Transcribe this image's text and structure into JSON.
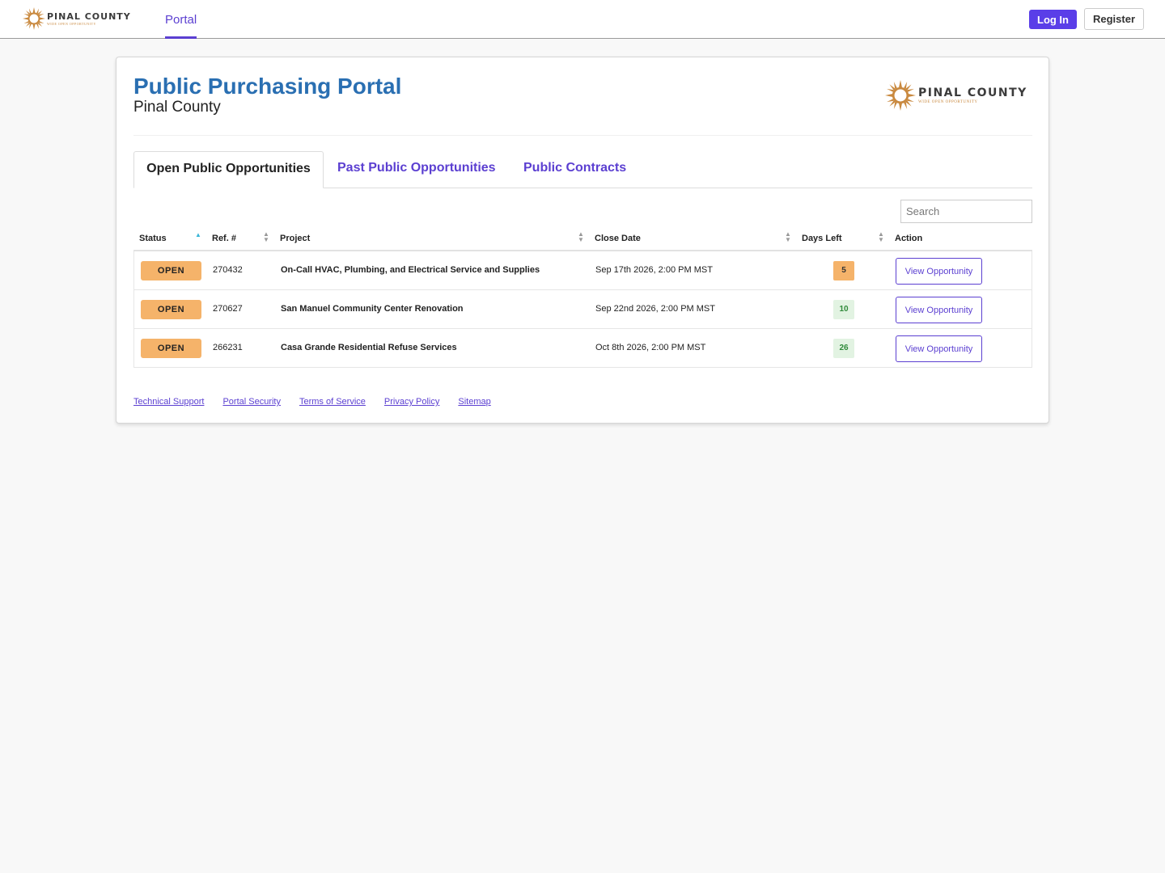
{
  "brand": {
    "name": "PINAL COUNTY",
    "tagline": "WIDE OPEN OPPORTUNITY"
  },
  "nav": {
    "portal_label": "Portal",
    "login_label": "Log In",
    "register_label": "Register"
  },
  "header": {
    "title": "Public Purchasing Portal",
    "subtitle": "Pinal County"
  },
  "tabs": [
    {
      "label": "Open Public Opportunities",
      "active": true
    },
    {
      "label": "Past Public Opportunities",
      "active": false
    },
    {
      "label": "Public Contracts",
      "active": false
    }
  ],
  "search": {
    "placeholder": "Search"
  },
  "table": {
    "columns": [
      "Status",
      "Ref. #",
      "Project",
      "Close Date",
      "Days Left",
      "Action"
    ],
    "rows": [
      {
        "status": "OPEN",
        "ref": "270432",
        "project": "On-Call HVAC, Plumbing, and Electrical Service and Supplies",
        "close_date": "Sep 17th 2026, 2:00 PM MST",
        "days_left": "5",
        "action": "View Opportunity"
      },
      {
        "status": "OPEN",
        "ref": "270627",
        "project": "San Manuel Community Center Renovation",
        "close_date": "Sep 22nd 2026, 2:00 PM MST",
        "days_left": "10",
        "action": "View Opportunity"
      },
      {
        "status": "OPEN",
        "ref": "266231",
        "project": "Casa Grande Residential Refuse Services",
        "close_date": "Oct 8th 2026, 2:00 PM MST",
        "days_left": "26",
        "action": "View Opportunity"
      }
    ]
  },
  "footer": {
    "links": [
      "Technical Support",
      "Portal Security",
      "Terms of Service",
      "Privacy Policy",
      "Sitemap"
    ]
  },
  "colors": {
    "accent": "#5b3fd1",
    "title_blue": "#2a6fb2",
    "status_open": "#f5b36a",
    "days_urgent": "#f5b36a",
    "days_ok": "#e2f3e2",
    "logo_orange": "#c9893f"
  },
  "icons": {
    "logo": "sunburst-logo-icon",
    "sort": "sort-arrows-icon"
  }
}
